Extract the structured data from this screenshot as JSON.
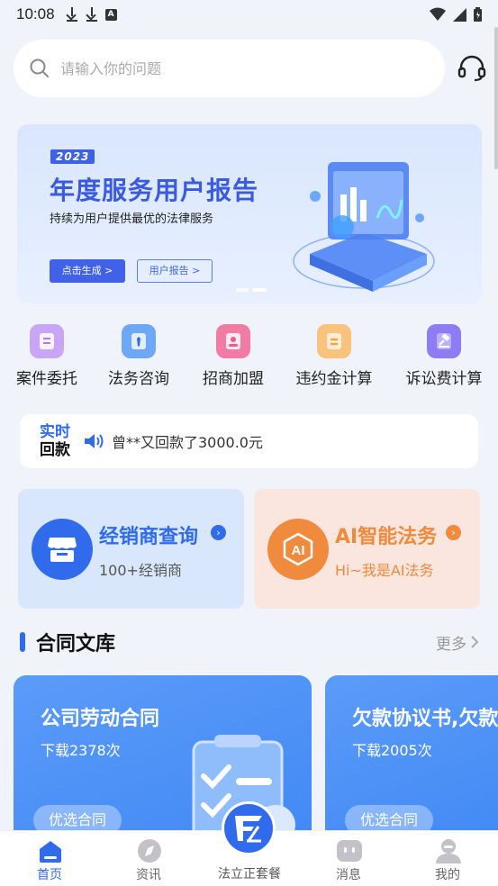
{
  "status_bar": {
    "time": "10:08",
    "icons_left": [
      "download-icon",
      "download-icon",
      "a-icon"
    ],
    "icons_right": [
      "wifi-icon",
      "signal-icon",
      "battery-icon"
    ]
  },
  "search": {
    "placeholder": "请输入你的问题",
    "icon": "search-icon",
    "service_icon": "headset-icon"
  },
  "banner": {
    "year": "2023",
    "title": "年度服务用户报告",
    "subtitle": "持续为用户提供最优的法律服务",
    "primary_button": "点击生成 >",
    "secondary_button": "用户报告 >",
    "active_slide": 2,
    "slides": 2
  },
  "quick_actions": [
    {
      "label": "案件委托",
      "icon": "document-icon",
      "color": "#b07cf0"
    },
    {
      "label": "法务咨询",
      "icon": "tie-icon",
      "color": "#3f8ef5"
    },
    {
      "label": "招商加盟",
      "icon": "person-card-icon",
      "color": "#ef5a8c"
    },
    {
      "label": "违约金计算",
      "icon": "calculator-icon",
      "color": "#f6a53c"
    },
    {
      "label": "诉讼费计算",
      "icon": "gavel-icon",
      "color": "#6f5cf0"
    }
  ],
  "ticker": {
    "tag_line1": "实时",
    "tag_line2": "回款",
    "text": "曾**又回款了3000.0元"
  },
  "promo_cards": {
    "left": {
      "title": "经销商查询",
      "subtitle": "100+经销商",
      "icon": "store-icon",
      "color": "#2f6bea"
    },
    "right": {
      "title": "AI智能法务",
      "subtitle": "Hi~我是AI法务",
      "icon": "ai-icon",
      "icon_text": "AI",
      "color": "#f08a3c"
    }
  },
  "section": {
    "title": "合同文库",
    "more": "更多"
  },
  "contracts": [
    {
      "title": "公司劳动合同",
      "downloads": "下载2378次",
      "tag": "优选合同"
    },
    {
      "title": "欠款协议书,欠款",
      "downloads": "下载2005次",
      "tag": "优选合同"
    }
  ],
  "tabbar": {
    "items": [
      {
        "label": "首页",
        "icon": "home-icon",
        "active": true
      },
      {
        "label": "资讯",
        "icon": "compass-icon",
        "active": false
      },
      {
        "label": "法立正套餐",
        "icon": "brand-logo-icon",
        "active": false
      },
      {
        "label": "消息",
        "icon": "message-icon",
        "active": false
      },
      {
        "label": "我的",
        "icon": "user-icon",
        "active": false
      }
    ]
  }
}
